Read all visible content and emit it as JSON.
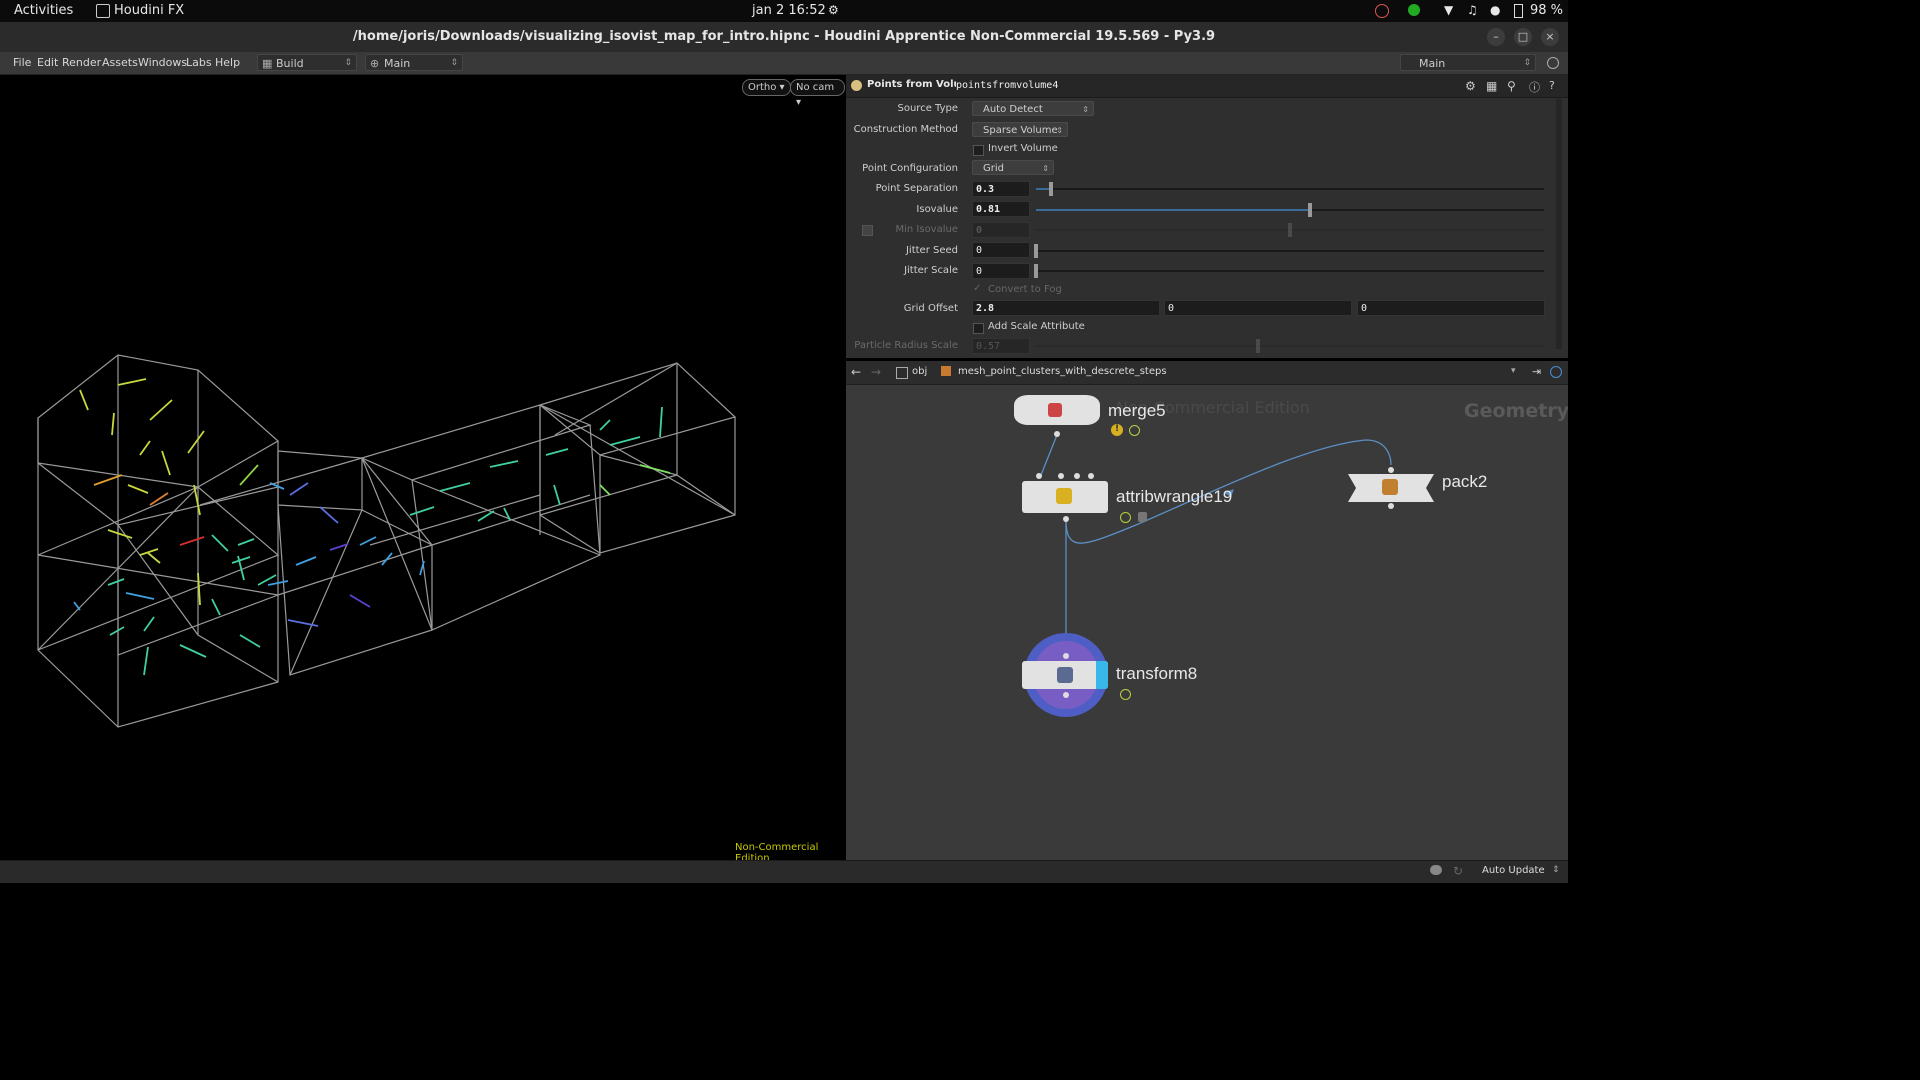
{
  "os_bar": {
    "activities": "Activities",
    "app_name": "Houdini FX",
    "clock": "jan 2  16:52",
    "battery": "98 %"
  },
  "window": {
    "title": "/home/joris/Downloads/visualizing_isovist_map_for_intro.hipnc - Houdini Apprentice Non-Commercial 19.5.569 - Py3.9"
  },
  "menu": {
    "items": [
      "File",
      "Edit",
      "Render",
      "Assets",
      "Windows",
      "Labs",
      "Help"
    ],
    "desktop_dropdown": "Build",
    "context_dropdown": "Main",
    "right_dropdown": "Main"
  },
  "viewport": {
    "ortho_btn": "Ortho",
    "cam_btn": "No cam",
    "watermark": "Non-Commercial Edition"
  },
  "params": {
    "node_type": "Points from Volume",
    "node_name": "pointsfromvolume4",
    "source_type_label": "Source Type",
    "source_type_value": "Auto Detect",
    "construction_label": "Construction Method",
    "construction_value": "Sparse Volume",
    "invert_volume": "Invert Volume",
    "point_config_label": "Point Configuration",
    "point_config_value": "Grid",
    "point_sep_label": "Point Separation",
    "point_sep_value": "0.3",
    "isovalue_label": "Isovalue",
    "isovalue_value": "0.81",
    "min_isovalue_label": "Min Isovalue",
    "min_isovalue_value": "0",
    "jitter_seed_label": "Jitter Seed",
    "jitter_seed_value": "0",
    "jitter_scale_label": "Jitter Scale",
    "jitter_scale_value": "0",
    "convert_to_fog": "Convert to Fog",
    "grid_offset_label": "Grid Offset",
    "grid_offset_x": "2.8",
    "grid_offset_y": "0",
    "grid_offset_z": "0",
    "add_scale_attr": "Add Scale Attribute",
    "particle_radius_label": "Particle Radius Scale",
    "particle_radius_value": "0.57"
  },
  "network": {
    "path_obj": "obj",
    "path_geo": "mesh_point_clusters_with_descrete_steps",
    "watermark": "Non-Commercial Edition",
    "context_label": "Geometry",
    "nodes": {
      "merge": "merge5",
      "wrangle": "attribwrangle19",
      "pack": "pack2",
      "transform": "transform8"
    }
  },
  "status": {
    "auto_update": "Auto Update"
  },
  "colors": {
    "accent_blue": "#3a6c9a",
    "wire": "#5b8fc6",
    "watermark_yellow": "#c8c800"
  }
}
